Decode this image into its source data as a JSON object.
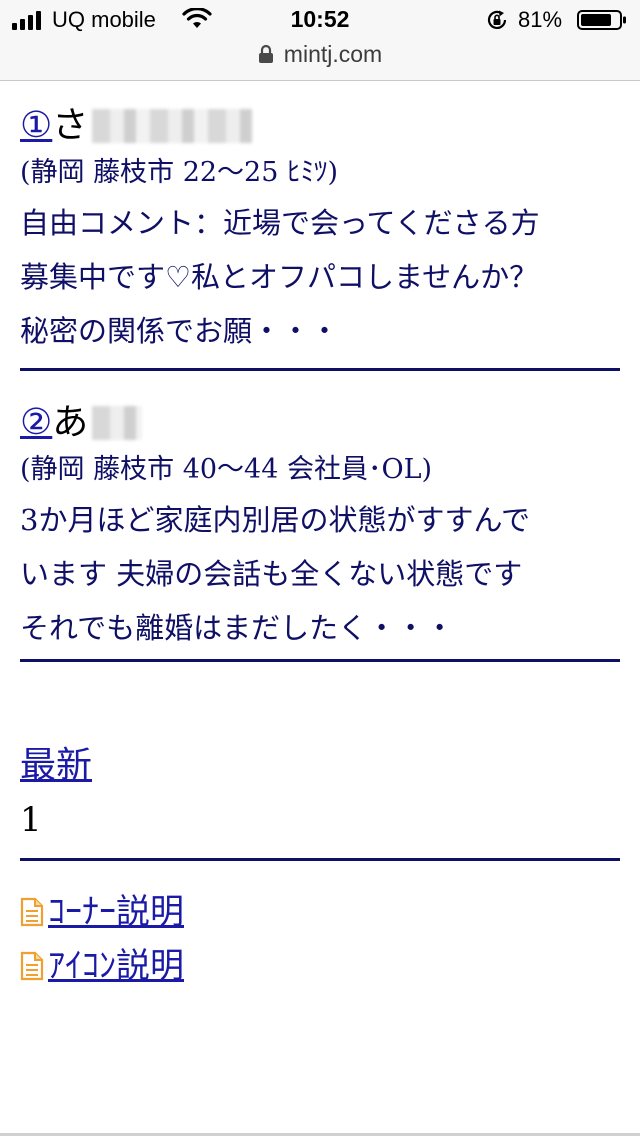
{
  "status_bar": {
    "carrier": "UQ mobile",
    "time": "10:52",
    "battery_percent": "81%",
    "battery_level": 0.81,
    "icons": [
      "signal-icon",
      "wifi-icon",
      "rotation-lock-icon",
      "battery-icon"
    ]
  },
  "url_bar": {
    "domain": "mintj.com",
    "icon": "lock-icon"
  },
  "posts": [
    {
      "number": "①",
      "name_initial": "さ",
      "meta": "(静岡 藤枝市 22〜25 ﾋﾐﾂ)",
      "body": [
        "自由コメント：近場で会ってくださる方",
        "募集中です♡私とオフパコしませんか？",
        "秘密の関係でお願・・・"
      ]
    },
    {
      "number": "②",
      "name_initial": "あ",
      "meta": "(静岡 藤枝市 40〜44 会社員･OL)",
      "body": [
        "3か月ほど家庭内別居の状態がすすんで",
        "います 夫婦の会話も全くない状態です",
        "それでも離婚はまだしたく・・・"
      ]
    }
  ],
  "pagination": {
    "latest_label": "最新",
    "page": "1"
  },
  "links": [
    {
      "label": "ｺｰﾅｰ説明",
      "icon": "document-icon"
    },
    {
      "label": "ｱｲｺﾝ説明",
      "icon": "document-icon"
    }
  ],
  "colors": {
    "text_navy": "#0f0f66",
    "link_blue": "#1a1aa6",
    "icon_orange": "#f0a030"
  }
}
